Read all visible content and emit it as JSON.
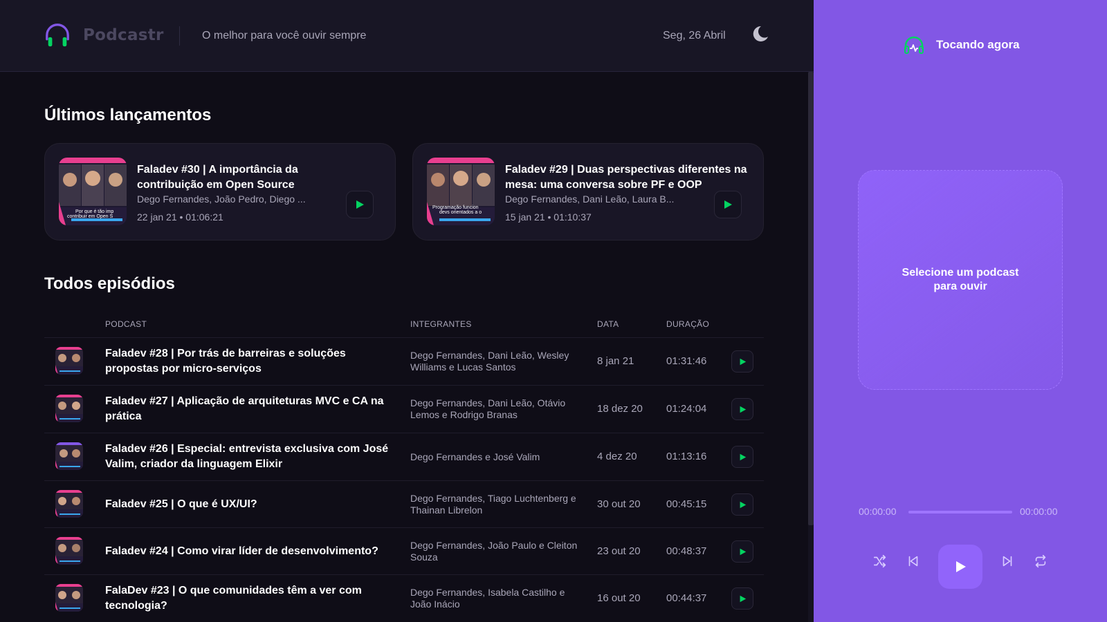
{
  "header": {
    "logo_text": "Podcastr",
    "tagline": "O melhor para você ouvir sempre",
    "date": "Seg, 26 Abril"
  },
  "latest": {
    "title": "Últimos lançamentos",
    "episodes": [
      {
        "title": "Faladev #30 | A importância da contribuição em Open Source",
        "members": "Dego Fernandes, João Pedro, Diego ...",
        "date": "22 jan 21",
        "duration": "01:06:21",
        "thumb_text": "Por que é tão imp contribuir em Open S"
      },
      {
        "title": "Faladev #29 | Duas perspectivas diferentes na mesa: uma conversa sobre PF e OOP",
        "members": "Dego Fernandes, Dani Leão, Laura B...",
        "date": "15 jan 21",
        "duration": "01:10:37",
        "thumb_text": "Programação funcion devs orientados a o"
      }
    ],
    "meta_separator": "•"
  },
  "all": {
    "title": "Todos episódios",
    "columns": [
      "PODCAST",
      "INTEGRANTES",
      "DATA",
      "DURAÇÃO"
    ],
    "rows": [
      {
        "title": "Faladev #28 | Por trás de barreiras e soluções propostas por micro-serviços",
        "members": "Dego Fernandes, Dani Leão, Wesley Williams e Lucas Santos",
        "date": "8 jan 21",
        "duration": "01:31:46"
      },
      {
        "title": "Faladev #27 | Aplicação de arquiteturas MVC e CA na prática",
        "members": "Dego Fernandes, Dani Leão, Otávio Lemos e Rodrigo Branas",
        "date": "18 dez 20",
        "duration": "01:24:04"
      },
      {
        "title": "Faladev #26 | Especial: entrevista exclusiva com José Valim, criador da linguagem Elixir",
        "members": "Dego Fernandes e José Valim",
        "date": "4 dez 20",
        "duration": "01:13:16"
      },
      {
        "title": "Faladev #25 | O que é UX/UI?",
        "members": "Dego Fernandes, Tiago Luchtenberg e Thainan Librelon",
        "date": "30 out 20",
        "duration": "00:45:15"
      },
      {
        "title": "Faladev #24 | Como virar líder de desenvolvimento?",
        "members": "Dego Fernandes, João Paulo e Cleiton Souza",
        "date": "23 out 20",
        "duration": "00:48:37"
      },
      {
        "title": "FalaDev #23 | O que comunidades têm a ver com tecnologia?",
        "members": "Dego Fernandes, Isabela Castilho e João Inácio",
        "date": "16 out 20",
        "duration": "00:44:37"
      }
    ]
  },
  "player": {
    "label": "Tocando agora",
    "empty_text": "Selecione um podcast para ouvir",
    "time_start": "00:00:00",
    "time_end": "00:00:00"
  },
  "colors": {
    "accent_green": "#04d361",
    "player_bg": "#8257e5",
    "brand_pink": "#e83f8f",
    "brand_blue": "#3aa7ee"
  },
  "icons": [
    "headphones-icon",
    "moon-icon",
    "play-icon",
    "shuffle-icon",
    "previous-icon",
    "next-icon",
    "repeat-icon"
  ]
}
